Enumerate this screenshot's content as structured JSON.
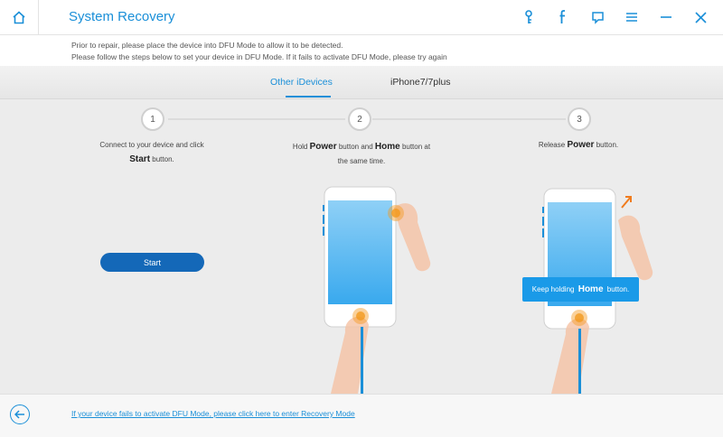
{
  "titlebar": {
    "title": "System Recovery",
    "icons": [
      "home-icon",
      "key-icon",
      "facebook-icon",
      "feedback-icon",
      "menu-icon",
      "minimize-icon",
      "close-icon"
    ]
  },
  "notice": {
    "line1": "Prior to repair, please place the device into DFU Mode to allow it to be detected.",
    "line2": "Please follow the steps below to set your device in DFU Mode. If it fails to activate DFU Mode, please try again"
  },
  "tabs": [
    {
      "label": "Other iDevices",
      "active": true
    },
    {
      "label": "iPhone7/7plus",
      "active": false
    }
  ],
  "steps": [
    {
      "number": "1",
      "text_a": "Connect to your device and click",
      "bold": "Start",
      "text_b": "button."
    },
    {
      "number": "2",
      "text_a": "Hold",
      "bold_a": "Power",
      "text_mid": "button and",
      "bold_b": "Home",
      "text_b": "button at",
      "text_c": "the same time."
    },
    {
      "number": "3",
      "text_a": "Release",
      "bold": "Power",
      "text_b": "button."
    }
  ],
  "start_button": "Start",
  "tooltip": {
    "text_a": "Keep holding",
    "bold": "Home",
    "text_b": "button."
  },
  "footer": {
    "link": "If your device fails to activate DFU Mode, please click here to enter Recovery Mode"
  },
  "colors": {
    "accent": "#1a8fd8",
    "button": "#1468b8",
    "screen": "#5db8f0",
    "finger": "#f5c2a4",
    "press": "#f39a1e"
  }
}
